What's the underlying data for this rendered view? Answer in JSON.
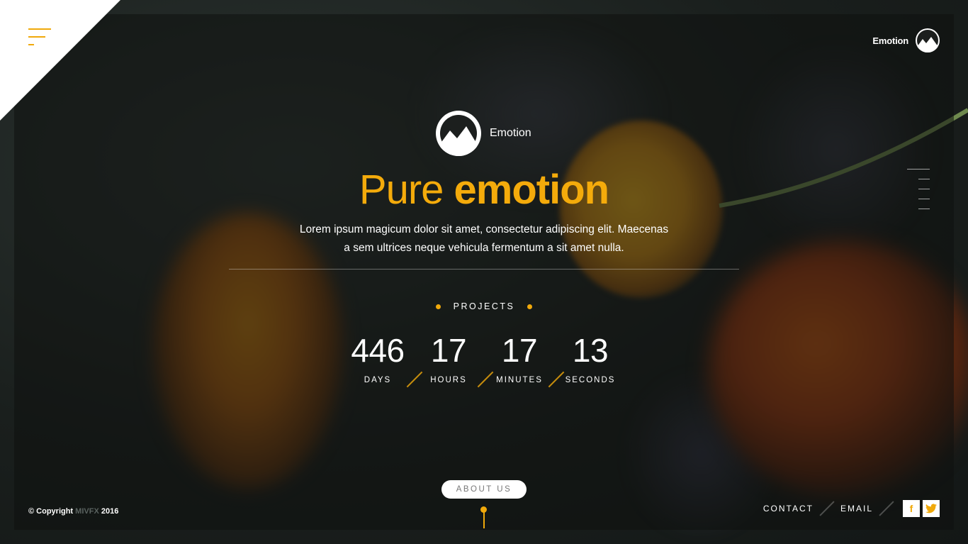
{
  "header": {
    "brand_name": "Emotion"
  },
  "hero": {
    "logo_name": "Emotion",
    "headline_regular": "Pure",
    "headline_bold": "emotion",
    "lead_line1": "Lorem ipsum magicum dolor sit amet, consectetur adipiscing elit. Maecenas",
    "lead_line2": "a sem ultrices neque vehicula fermentum a sit amet nulla."
  },
  "countdown": {
    "label": "PROJECTS",
    "items": [
      {
        "value": "446",
        "label": "DAYS"
      },
      {
        "value": "17",
        "label": "HOURS"
      },
      {
        "value": "17",
        "label": "MINUTES"
      },
      {
        "value": "13",
        "label": "SECONDS"
      }
    ]
  },
  "about_button": "ABOUT US",
  "footer": {
    "copyright_prefix": "© Copyright",
    "copyright_brand": "MIVFX",
    "copyright_year": "2016",
    "links": [
      "CONTACT",
      "EMAIL"
    ],
    "social": [
      {
        "icon": "facebook-icon",
        "glyph": "f"
      },
      {
        "icon": "twitter-icon",
        "glyph": "t"
      }
    ]
  },
  "colors": {
    "accent": "#f0a90b",
    "text": "#ffffff"
  }
}
